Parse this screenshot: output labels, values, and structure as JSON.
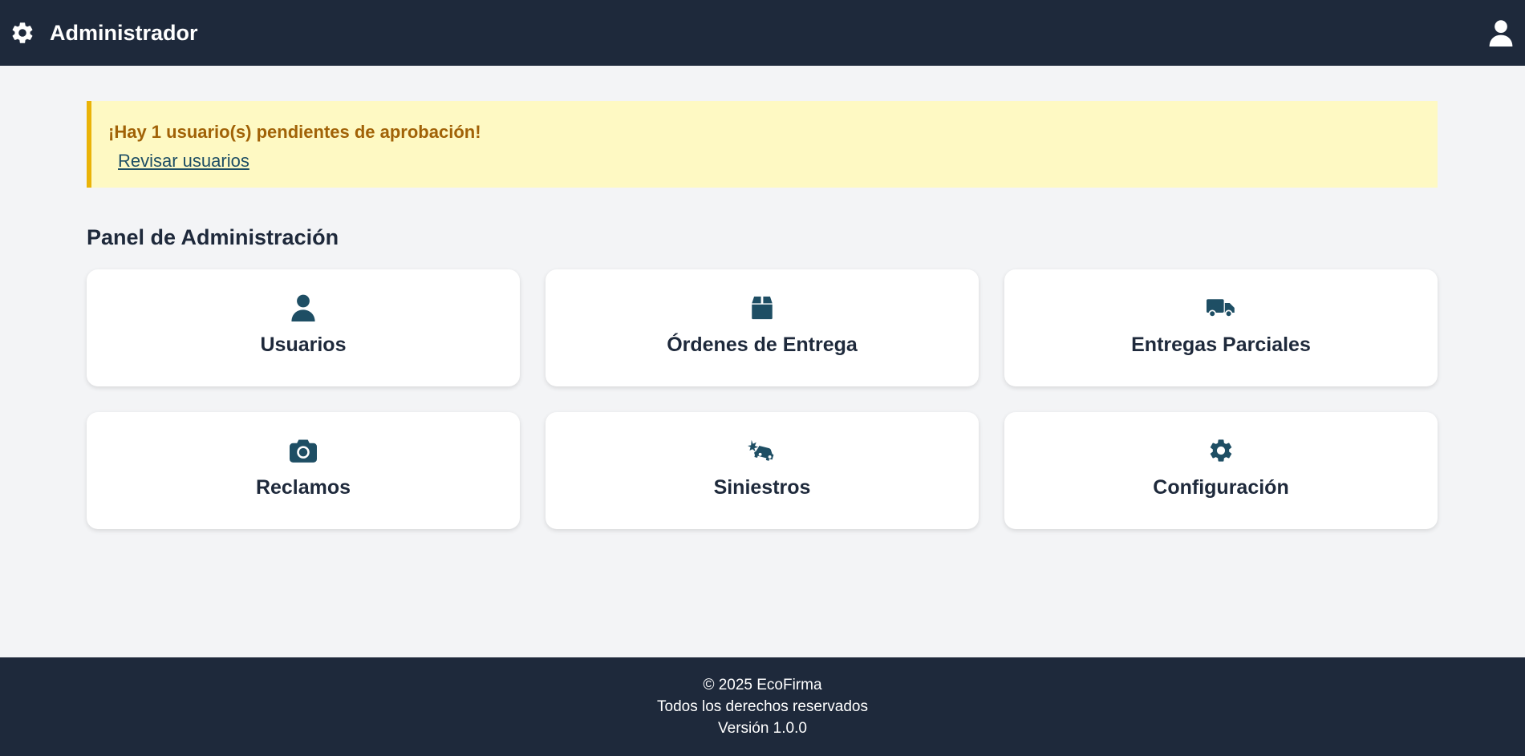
{
  "header": {
    "title": "Administrador",
    "left_icon": "gear-icon",
    "right_icon": "user-icon"
  },
  "alert": {
    "message": "¡Hay 1 usuario(s) pendientes de aprobación!",
    "link_label": "Revisar usuarios"
  },
  "panel": {
    "title": "Panel de Administración",
    "cards": [
      {
        "label": "Usuarios",
        "icon": "user-icon"
      },
      {
        "label": "Órdenes de Entrega",
        "icon": "box-icon"
      },
      {
        "label": "Entregas Parciales",
        "icon": "truck-icon"
      },
      {
        "label": "Reclamos",
        "icon": "camera-icon"
      },
      {
        "label": "Siniestros",
        "icon": "car-crash-icon"
      },
      {
        "label": "Configuración",
        "icon": "gear-icon"
      }
    ]
  },
  "footer": {
    "copyright": "© 2025 EcoFirma",
    "rights": "Todos los derechos reservados",
    "version": "Versión 1.0.0"
  },
  "colors": {
    "header_bg": "#1e293b",
    "page_bg": "#f3f4f6",
    "alert_bg": "#fef9c3",
    "alert_border": "#eab308",
    "alert_text": "#a16207",
    "icon_color": "#1e4e64"
  }
}
